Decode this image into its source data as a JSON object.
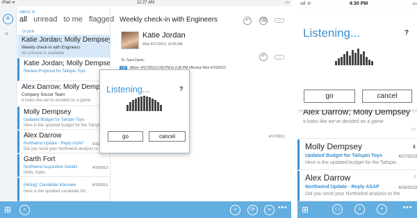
{
  "ipad": {
    "status": {
      "carrier": "iPad ᯤ",
      "time": "11:27 AM",
      "battery": "▭"
    },
    "compose_glyph": "+",
    "expand_glyph": "»",
    "inbox_header": "INBOX",
    "inbox_count": "32",
    "filters": [
      "all",
      "unread",
      "to me",
      "flagged"
    ],
    "older_label": "OLDER",
    "messages": [
      {
        "from": "Katie Jordan; Molly Dempsey",
        "subject": "Weekly check-in with Engineers",
        "preview": "No preview is available",
        "date": "",
        "flag": ""
      },
      {
        "from": "Katie Jordan; Molly Dempsey",
        "subject": "Review Proposal for Tailspin Toys",
        "preview": "",
        "date": "",
        "flag": ""
      },
      {
        "from": "Alex Darrow; Molly Dempsey",
        "subject": "Company Soccer Team",
        "preview": "It looks like we've decided on a game",
        "date": "",
        "flag": ""
      },
      {
        "from": "Molly Dempsey",
        "subject": "Updated Budget for Tailspin Toys",
        "preview": "Here is the updated budget for the Tailspin",
        "date": "",
        "flag": ""
      },
      {
        "from": "Alex Darrow",
        "subject": "Northwind Update - Reply ASAP",
        "preview": "Did you send your Northwind analysis to the",
        "date": "4/16/2013",
        "flag": ""
      },
      {
        "from": "Garth Fort",
        "subject": "Northwind Acquisition Details",
        "preview": "Hello, Katie.",
        "date": "4/16/2013",
        "flag": ""
      },
      {
        "from": "[Hiring]: Candidate Interview",
        "subject": "",
        "preview": "Here is the updated candidate list",
        "date": "4/16/2013",
        "flag": ""
      }
    ],
    "reading": {
      "subject": "Weekly check-in with Engineers",
      "sender": "Katie Jordan",
      "sent": "Wed 4/17/2013, 10:05 AM",
      "to": "To: Sara Davis;",
      "att_badge": "ctrl",
      "att_text": "When: 4/17/2013 2:00 PM to 2:30 PM effective Mon 4/15/2013",
      "body_frag": "eting",
      "date_right": "4/17/2013"
    },
    "dialog": {
      "title": "Listening...",
      "help": "?",
      "go": "go",
      "cancel": "cancel"
    },
    "appbar": {
      "grid": "⊞",
      "search": "⌕",
      "add": "+",
      "infinity": "∞",
      "more": "•••"
    }
  },
  "iphone": {
    "status": {
      "carrier": "ıııl ᯤ",
      "time": "4:30 PM",
      "battery": "▭"
    },
    "dialog": {
      "title": "Listening...",
      "help": "?",
      "go": "go",
      "cancel": "cancel"
    },
    "messages": [
      {
        "from": "Alex Darrow; Molly Dempsey",
        "subject": "",
        "preview": "It looks like we've decided on a game",
        "date": "",
        "icon": ""
      },
      {
        "from": "Molly Dempsey",
        "subject": "Updated Budget for Tailspin Toys",
        "preview": "Here is the updated budget for the Tailspin",
        "date": "4/17/2013",
        "icon": ""
      },
      {
        "from": "Alex Darrow",
        "subject": "Northwind Update - Reply ASAP",
        "preview": "Did you send your Northwind analysis to the",
        "date": "4/16/2013",
        "icon": "!"
      }
    ],
    "appbar": {
      "grid": "⊞",
      "folder": "▭",
      "search": "⌕",
      "add": "+",
      "more": "•••"
    }
  }
}
